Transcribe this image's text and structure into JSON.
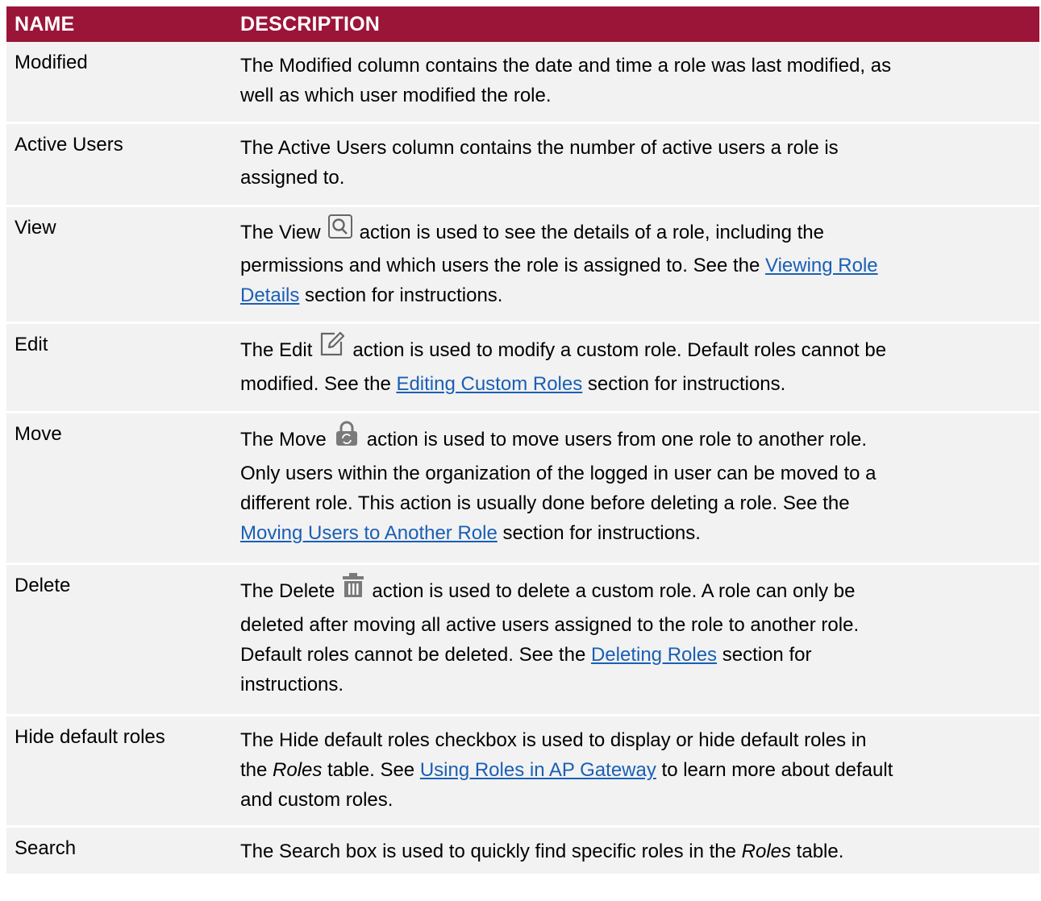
{
  "header": {
    "name": "NAME",
    "description": "DESCRIPTION"
  },
  "colors": {
    "header_bg": "#9b1538",
    "row_bg": "#f2f2f2",
    "link": "#1a5fb4"
  },
  "rows": [
    {
      "name": "Modified",
      "lines": [
        [
          "The Modified column contains the date and time a role was last modified, as"
        ],
        [
          "well as which user modified the role."
        ]
      ]
    },
    {
      "name": "Active Users",
      "lines": [
        [
          "The Active Users column contains the number of active users a role is"
        ],
        [
          "assigned to."
        ]
      ]
    },
    {
      "name": "View",
      "icon": "view-magnifier-icon",
      "line1_pre": "The View",
      "line1_post": "action is used to see the details of a role, including the",
      "line2": "permissions and which users the role is assigned to. See the ",
      "link_part1": "Viewing Role",
      "link_part2": "Details",
      "line3_post": " section for instructions."
    },
    {
      "name": "Edit",
      "icon": "edit-pencil-icon",
      "line1_pre": "The Edit",
      "line1_post": "action is used to modify a custom role. Default roles cannot be",
      "line2_pre": "modified. See the ",
      "link": "Editing Custom Roles",
      "line2_post": " section for instructions."
    },
    {
      "name": "Move",
      "icon": "move-lock-icon",
      "line1_pre": "The Move",
      "line1_post": "action is used to move users from one role to another role.",
      "line2": "Only users within the organization of the logged in user can be moved to a",
      "line3": "different role. This action is usually done before deleting a role. See the",
      "link": "Moving Users to Another Role",
      "line4_post": " section for instructions."
    },
    {
      "name": "Delete",
      "icon": "delete-trash-icon",
      "line1_pre": "The Delete",
      "line1_post": "action is used to delete a custom role. A role can only be",
      "line2": "deleted after moving all active users assigned to the role to another role.",
      "line3_pre": "Default roles cannot be deleted. See the ",
      "link": "Deleting Roles",
      "line3_post": " section for",
      "line4": "instructions."
    },
    {
      "name": "Hide default roles",
      "line1": "The Hide default roles checkbox is used to display or hide default roles in",
      "line2_pre": "the ",
      "line2_italic": "Roles",
      "line2_mid": " table. See ",
      "link": "Using Roles in AP Gateway",
      "line2_post": " to learn more about default",
      "line3": "and custom roles."
    },
    {
      "name": "Search",
      "line1_pre": "The Search box is used to quickly find specific roles in the ",
      "line1_italic": "Roles",
      "line1_post": " table."
    }
  ]
}
